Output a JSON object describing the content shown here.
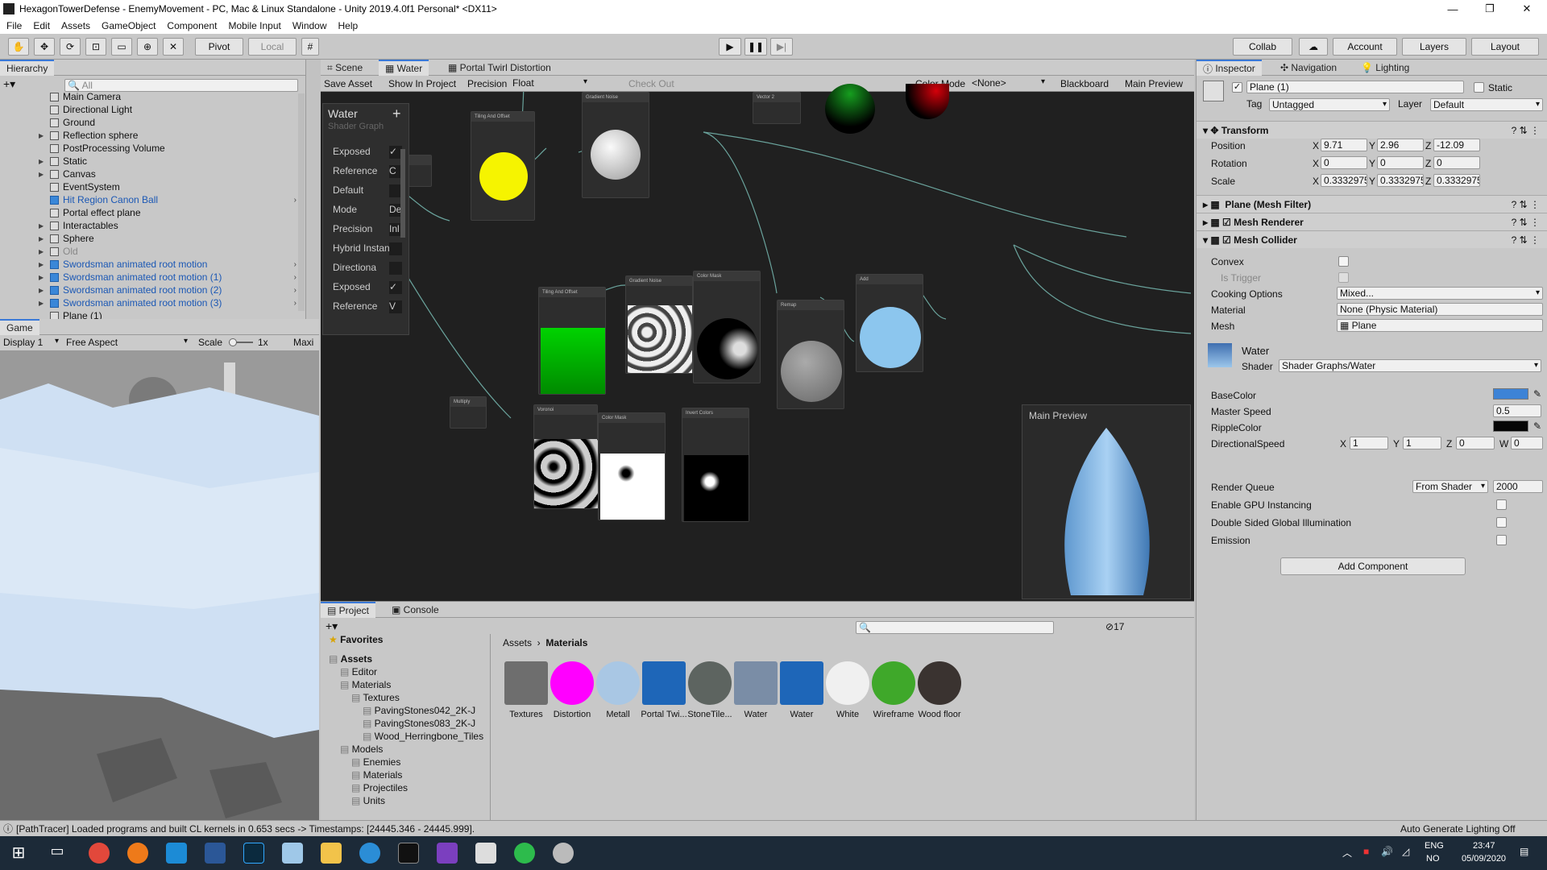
{
  "window": {
    "title": "HexagonTowerDefense - EnemyMovement - PC, Mac & Linux Standalone - Unity 2019.4.0f1 Personal* <DX11>"
  },
  "menu": [
    "File",
    "Edit",
    "Assets",
    "GameObject",
    "Component",
    "Mobile Input",
    "Window",
    "Help"
  ],
  "toolbar": {
    "pivot": "Pivot",
    "local": "Local",
    "collab": "Collab",
    "account": "Account",
    "layers": "Layers",
    "layout": "Layout"
  },
  "hierarchy": {
    "title": "Hierarchy",
    "search_placeholder": "All",
    "items": [
      {
        "label": "Main Camera",
        "style": "normal",
        "arrow": false
      },
      {
        "label": "Directional Light",
        "style": "normal",
        "arrow": false
      },
      {
        "label": "Ground",
        "style": "normal",
        "arrow": false
      },
      {
        "label": "Reflection sphere",
        "style": "normal",
        "arrow": true
      },
      {
        "label": "PostProcessing Volume",
        "style": "normal",
        "arrow": false
      },
      {
        "label": "Static",
        "style": "normal",
        "arrow": true
      },
      {
        "label": "Canvas",
        "style": "normal",
        "arrow": true
      },
      {
        "label": "EventSystem",
        "style": "normal",
        "arrow": false
      },
      {
        "label": "Hit Region Canon Ball",
        "style": "blue",
        "arrow": false
      },
      {
        "label": "Portal  effect plane",
        "style": "normal",
        "arrow": false
      },
      {
        "label": "Interactables",
        "style": "normal",
        "arrow": true
      },
      {
        "label": "Sphere",
        "style": "normal",
        "arrow": true
      },
      {
        "label": "Old",
        "style": "gray",
        "arrow": true
      },
      {
        "label": "Swordsman animated root motion",
        "style": "blue",
        "arrow": true
      },
      {
        "label": "Swordsman animated root motion (1)",
        "style": "blue",
        "arrow": true
      },
      {
        "label": "Swordsman animated root motion (2)",
        "style": "blue",
        "arrow": true
      },
      {
        "label": "Swordsman animated root motion (3)",
        "style": "blue",
        "arrow": true
      },
      {
        "label": "Plane (1)",
        "style": "normal",
        "arrow": false
      }
    ]
  },
  "game": {
    "tab": "Game",
    "display": "Display 1",
    "aspect": "Free Aspect",
    "scale_label": "Scale",
    "scale_value": "1x",
    "maximize": "Maxi"
  },
  "center_tabs": [
    "Scene",
    "Water",
    "Portal Twirl Distortion"
  ],
  "shadergraph": {
    "save": "Save Asset",
    "show": "Show In Project",
    "precision_label": "Precision",
    "precision": "Float",
    "checkout": "Check Out",
    "colormode_label": "Color Mode",
    "colormode": "<None>",
    "blackboard": "Blackboard",
    "mainpreview": "Main Preview"
  },
  "blackboard": {
    "title": "Water",
    "subtitle": "Shader Graph",
    "rows": [
      {
        "label": "Exposed",
        "value": "✓"
      },
      {
        "label": "Reference",
        "value": "C"
      },
      {
        "label": "Default",
        "value": ""
      },
      {
        "label": "Mode",
        "value": "Def"
      },
      {
        "label": "Precision",
        "value": "Inl"
      },
      {
        "label": "Hybrid Instan",
        "value": ""
      },
      {
        "label": "Directiona",
        "value": ""
      },
      {
        "label": "Exposed",
        "value": "✓"
      },
      {
        "label": "Reference",
        "value": "V"
      }
    ]
  },
  "main_preview": {
    "title": "Main Preview"
  },
  "nodes": [
    {
      "title": "Tiling And Offset"
    },
    {
      "title": "Gradient Noise"
    },
    {
      "title": "Vector 2"
    },
    {
      "title": "Multiply"
    },
    {
      "title": "Tiling And Offset"
    },
    {
      "title": "Gradient Noise"
    },
    {
      "title": "Color Mask"
    },
    {
      "title": "Remap"
    },
    {
      "title": "Add"
    },
    {
      "title": "Multiply"
    },
    {
      "title": "Voronoi"
    },
    {
      "title": "Color Mask"
    },
    {
      "title": "Invert Colors"
    }
  ],
  "inspector": {
    "tabs": [
      "Inspector",
      "Navigation",
      "Lighting"
    ],
    "object_name": "Plane (1)",
    "static": "Static",
    "tag_label": "Tag",
    "tag": "Untagged",
    "layer_label": "Layer",
    "layer": "Default",
    "transform": {
      "title": "Transform",
      "rows": [
        {
          "label": "Position",
          "x": "9.71",
          "y": "2.96",
          "z": "-12.09"
        },
        {
          "label": "Rotation",
          "x": "0",
          "y": "0",
          "z": "0"
        },
        {
          "label": "Scale",
          "x": "0.3332975",
          "y": "0.3332975",
          "z": "0.3332975"
        }
      ]
    },
    "components": [
      "Plane (Mesh Filter)",
      "Mesh Renderer",
      "Mesh Collider"
    ],
    "collider": {
      "convex": "Convex",
      "trigger": "Is Trigger",
      "cooking_label": "Cooking Options",
      "cooking": "Mixed...",
      "material_label": "Material",
      "material": "None (Physic Material)",
      "mesh_label": "Mesh",
      "mesh": "Plane"
    },
    "material": {
      "name": "Water",
      "shader_label": "Shader",
      "shader": "Shader Graphs/Water",
      "base_color": "BaseColor",
      "master_speed_label": "Master Speed",
      "master_speed": "0.5",
      "ripple": "RippleColor",
      "dir_label": "DirectionalSpeed",
      "dir": {
        "x": "1",
        "y": "1",
        "z": "0",
        "w": "0"
      },
      "rq_label": "Render Queue",
      "rq_mode": "From Shader",
      "rq": "2000",
      "gpu": "Enable GPU Instancing",
      "dsgi": "Double Sided Global Illumination",
      "emission": "Emission"
    },
    "add_component": "Add Component"
  },
  "project": {
    "tabs": [
      "Project",
      "Console"
    ],
    "count": "17",
    "breadcrumb": [
      "Assets",
      "Materials"
    ],
    "tree": [
      {
        "label": "Favorites",
        "bold": true,
        "indent": 0
      },
      {
        "label": "Assets",
        "bold": true,
        "indent": 0
      },
      {
        "label": "Editor",
        "indent": 1
      },
      {
        "label": "Materials",
        "indent": 1
      },
      {
        "label": "Textures",
        "indent": 2
      },
      {
        "label": "PavingStones042_2K-J",
        "indent": 3
      },
      {
        "label": "PavingStones083_2K-J",
        "indent": 3
      },
      {
        "label": "Wood_Herringbone_Tiles",
        "indent": 3
      },
      {
        "label": "Models",
        "indent": 1
      },
      {
        "label": "Enemies",
        "indent": 2
      },
      {
        "label": "Materials",
        "indent": 2
      },
      {
        "label": "Projectiles",
        "indent": 2
      },
      {
        "label": "Units",
        "indent": 2
      }
    ],
    "assets": [
      {
        "label": "Textures",
        "color": "#6e6e6e"
      },
      {
        "label": "Distortion",
        "color": "#ff00ff"
      },
      {
        "label": "Metall",
        "color": "#a9c7e4"
      },
      {
        "label": "Portal Twi...",
        "color": "#1e66b8"
      },
      {
        "label": "StoneTile...",
        "color": "#5d6460"
      },
      {
        "label": "Water",
        "color": "#7a8da6"
      },
      {
        "label": "Water",
        "color": "#1e66b8"
      },
      {
        "label": "White",
        "color": "#f0f0f0"
      },
      {
        "label": "Wireframe",
        "color": "#3fa82a"
      },
      {
        "label": "Wood floor",
        "color": "#3a3330"
      }
    ]
  },
  "status": {
    "message": "[PathTracer] Loaded programs and built CL kernels in 0.653 secs -> Timestamps: [24445.346 - 24445.999].",
    "lighting": "Auto Generate Lighting Off"
  },
  "taskbar": {
    "lang1": "ENG",
    "lang2": "NO",
    "time": "23:47",
    "date": "05/09/2020"
  }
}
